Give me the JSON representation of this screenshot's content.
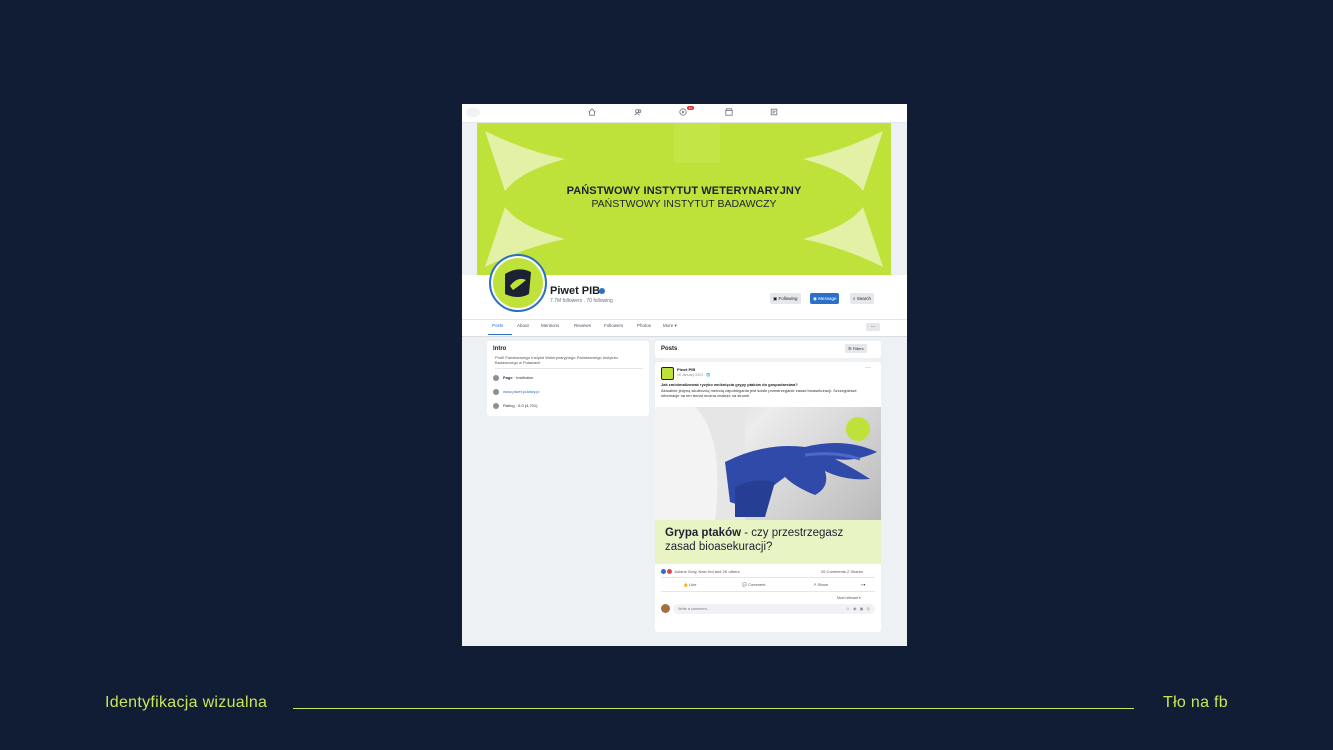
{
  "slide": {
    "footer_left": "Identyfikacja wizualna",
    "footer_right": "Tło na fb",
    "accent_color": "#c9e65a",
    "background_color": "#111d35"
  },
  "topnav": {
    "icons": [
      "home-icon",
      "friends-icon",
      "video-icon",
      "marketplace-icon",
      "gaming-icon"
    ],
    "notification_badge": "9+"
  },
  "cover": {
    "title": "PAŃSTWOWY INSTYTUT WETERYNARYJNY",
    "subtitle": "PAŃSTWOWY INSTYTUT BADAWCZY",
    "color": "#bfe23a"
  },
  "profile": {
    "name": "Piwet PIB",
    "stats": "7.7M followers . 70 following",
    "buttons": {
      "following": "Following",
      "message": "Message",
      "search": "Search"
    }
  },
  "tabs": {
    "items": [
      "Posts",
      "About",
      "Mentions",
      "Reviews",
      "Followers",
      "Photos",
      "More ▾"
    ],
    "more_dots": "···"
  },
  "intro": {
    "title": "Intro",
    "description": "Profil Państwowego Instytut Weterynaryjnego-Państwowego Instytutu Badawczego w Puławach",
    "page_label": "Page",
    "page_value": "· Institution",
    "website": "www.piwet.pulawy.pl",
    "rating": "Rating · 5.0 (4,701)"
  },
  "posts": {
    "title": "Posts",
    "filters_label": "☰ Filters",
    "post": {
      "author": "Piwet PIB",
      "date": "16 January 2023 · 🌐",
      "headline": "Jak zminimalizować ryzyko wniknięcia grypy ptaków do gospodarstwa?",
      "body": "Aktualnie jedyną skuteczną metodą zapobiegania jest ścisłe przestrzeganie zasad bioasekuracji. Szczegółowe informacje na ten temat można znaleźć na stronie.",
      "banner_bold": "Grypa ptaków",
      "banner_rest": " - czy przestrzegasz zasad bioasekuracji?",
      "reactions": "Juliane Gray, Nasi Hol and 2K others",
      "counts": "26 Comments  2 Shares",
      "actions": {
        "like": "👍 Like",
        "comment": "💬 Comment",
        "share": "↗ Share"
      },
      "sort": "Most relevant ▾",
      "comment_placeholder": "Write a comment...",
      "comment_icons": "☺ ◉ ▣ ◎"
    }
  }
}
